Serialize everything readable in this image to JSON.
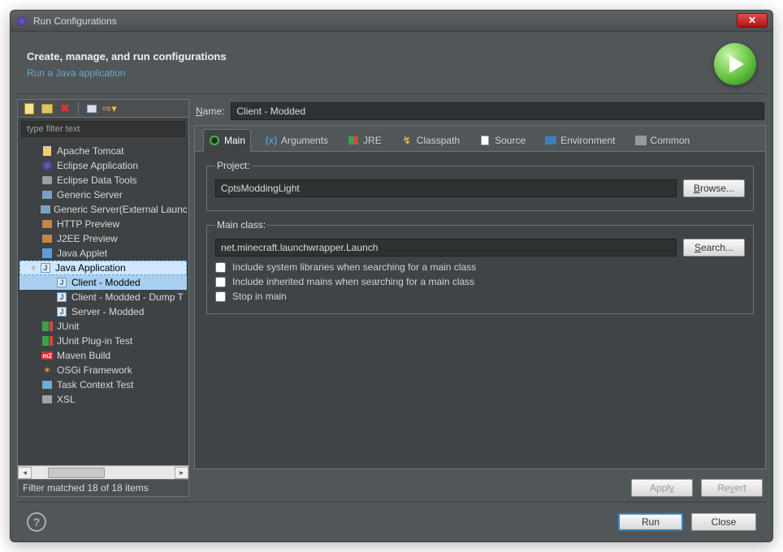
{
  "window": {
    "title": "Run Configurations"
  },
  "header": {
    "title": "Create, manage, and run configurations",
    "subtitle": "Run a Java application"
  },
  "sidebar": {
    "filter_placeholder": "type filter text",
    "items": [
      {
        "label": "Apache Tomcat"
      },
      {
        "label": "Eclipse Application"
      },
      {
        "label": "Eclipse Data Tools"
      },
      {
        "label": "Generic Server"
      },
      {
        "label": "Generic Server(External Launc"
      },
      {
        "label": "HTTP Preview"
      },
      {
        "label": "J2EE Preview"
      },
      {
        "label": "Java Applet"
      },
      {
        "label": "Java Application",
        "expanded": true,
        "children": [
          {
            "label": "Client - Modded",
            "selected": true
          },
          {
            "label": "Client - Modded - Dump T"
          },
          {
            "label": "Server - Modded"
          }
        ]
      },
      {
        "label": "JUnit"
      },
      {
        "label": "JUnit Plug-in Test"
      },
      {
        "label": "Maven Build"
      },
      {
        "label": "OSGi Framework"
      },
      {
        "label": "Task Context Test"
      },
      {
        "label": "XSL"
      }
    ],
    "status": "Filter matched 18 of 18 items"
  },
  "form": {
    "name_label": "Name:",
    "name_value": "Client - Modded",
    "tabs": {
      "main": "Main",
      "arguments": "Arguments",
      "jre": "JRE",
      "classpath": "Classpath",
      "source": "Source",
      "environment": "Environment",
      "common": "Common"
    },
    "project": {
      "legend": "Project:",
      "value": "CptsModdingLight",
      "browse": "Browse..."
    },
    "mainclass": {
      "legend": "Main class:",
      "value": "net.minecraft.launchwrapper.Launch",
      "search": "Search...",
      "check1": "Include system libraries when searching for a main class",
      "check2": "Include inherited mains when searching for a main class",
      "check3": "Stop in main"
    },
    "apply": "Apply",
    "revert": "Revert"
  },
  "footer": {
    "run": "Run",
    "close": "Close"
  }
}
